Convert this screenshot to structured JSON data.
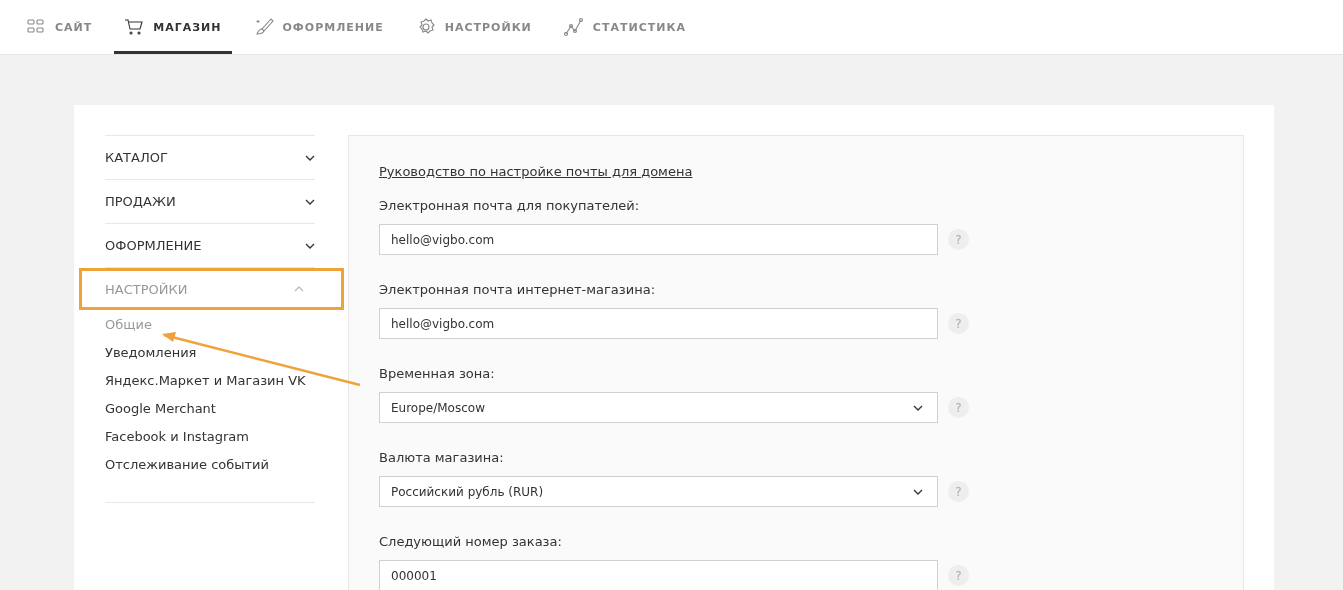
{
  "top_nav": [
    {
      "label": "САЙТ",
      "selected": false
    },
    {
      "label": "МАГАЗИН",
      "selected": true
    },
    {
      "label": "ОФОРМЛЕНИЕ",
      "selected": false
    },
    {
      "label": "НАСТРОЙКИ",
      "selected": false
    },
    {
      "label": "СТАТИСТИКА",
      "selected": false
    }
  ],
  "annotation_arrow": true,
  "sidebar": {
    "sections": [
      {
        "label": "КАТАЛОГ",
        "expanded": false,
        "highlighted": false
      },
      {
        "label": "ПРОДАЖИ",
        "expanded": false,
        "highlighted": false
      },
      {
        "label": "ОФОРМЛЕНИЕ",
        "expanded": false,
        "highlighted": false
      },
      {
        "label": "НАСТРОЙКИ",
        "expanded": true,
        "highlighted": true,
        "children": [
          {
            "label": "Общие",
            "selected": true
          },
          {
            "label": "Уведомления",
            "selected": false
          },
          {
            "label": "Яндекс.Маркет и Магазин VK",
            "selected": false
          },
          {
            "label": "Google Merchant",
            "selected": false
          },
          {
            "label": "Facebook и Instagram",
            "selected": false
          },
          {
            "label": "Отслеживание событий",
            "selected": false
          }
        ]
      }
    ]
  },
  "form": {
    "link": "Руководство по настройке почты для домена",
    "fields": [
      {
        "label": "Электронная почта для покупателей:",
        "kind": "text",
        "value": "hello@vigbo.com",
        "help": "?"
      },
      {
        "label": "Электронная почта интернет-магазина:",
        "kind": "text",
        "value": "hello@vigbo.com",
        "help": "?"
      },
      {
        "label": "Временная зона:",
        "kind": "select",
        "value": "Europe/Moscow",
        "help": "?"
      },
      {
        "label": "Валюта магазина:",
        "kind": "select",
        "value": "Российский рубль (RUR)",
        "help": "?"
      },
      {
        "label": "Следующий номер заказа:",
        "kind": "text",
        "value": "000001",
        "help": "?"
      }
    ]
  }
}
